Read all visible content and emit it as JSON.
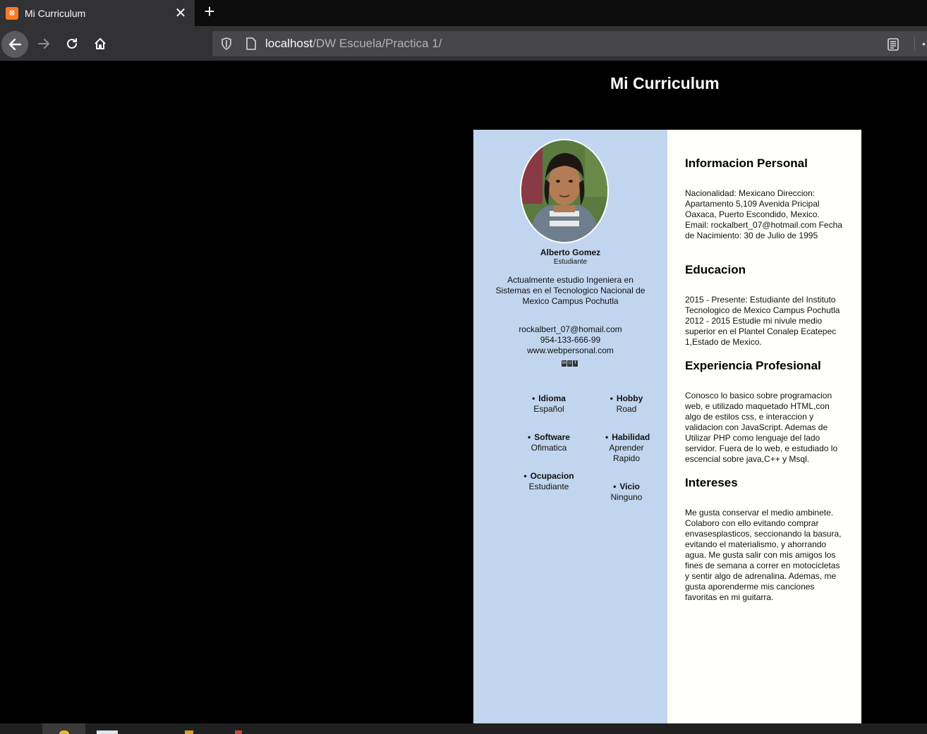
{
  "browser": {
    "tab_title": "Mi Curriculum",
    "tab_favicon_text": "⦻",
    "close_icon": "✕",
    "newtab_icon": "+",
    "url_host": "localhost",
    "url_path": "/DW Escuela/Practica 1/",
    "more_icon": "•"
  },
  "page": {
    "title": "Mi Curriculum"
  },
  "profile": {
    "name": "Alberto Gomez",
    "role": "Estudiante",
    "summary": "Actualmente estudio Ingeniera en Sistemas en el Tecnologico Nacional de Mexico Campus Pochutla",
    "email": "rockalbert_07@homail.com",
    "phone": "954-133-666-99",
    "website": "www.webpersonal.com",
    "socials": [
      "in",
      "◎",
      "f"
    ]
  },
  "info": {
    "idioma": {
      "label": "Idioma",
      "value": "Español"
    },
    "hobby": {
      "label": "Hobby",
      "value": "Road"
    },
    "software": {
      "label": "Software",
      "value": "Ofimatica"
    },
    "habilidad": {
      "label": "Habilidad",
      "value": "Aprender Rapido"
    },
    "ocupacion": {
      "label": "Ocupacion",
      "value": "Estudiante"
    },
    "vicio": {
      "label": "Vicio",
      "value": "Ninguno"
    }
  },
  "sections": {
    "personal": {
      "title": "Informacion Personal",
      "text": "Nacionalidad: Mexicano Direccion: Apartamento 5,109 Avenida Pricipal Oaxaca, Puerto Escondido, Mexico. Email: rockalbert_07@hotmail.com Fecha de Nacimiento: 30 de Julio de 1995"
    },
    "educacion": {
      "title": "Educacion",
      "text": "2015 - Presente: Estudiante del Instituto Tecnologico de Mexico Campus Pochutla 2012 - 2015 Estudie mi nivule medio superior en el Plantel Conalep Ecatepec 1,Estado de Mexico."
    },
    "experiencia": {
      "title": "Experiencia Profesional",
      "text": "Conosco lo basico sobre programacion web, e utilizado maquetado HTML,con algo de estilos css, e interaccion y validacion con JavaScript. Ademas de Utilizar PHP como lenguaje del lado servidor. Fuera de lo web, e estudiado lo escencial sobre java,C++ y Msql."
    },
    "intereses": {
      "title": "Intereses",
      "text": "Me gusta conservar el medio ambinete. Colaboro con ello evitando comprar envasesplasticos, seccionando la basura, evitando el materialismo, y ahorrando agua. Me gusta salir con mis amigos los fines de semana a correr en motocicletas y sentir algo de adrenalina. Ademas, me gusta aporenderme mis canciones favoritas en mi guitarra."
    }
  },
  "colors": {
    "left_column": "#c2d5ee",
    "right_column": "#fffffb",
    "page_background": "#000000",
    "chrome": "#323234"
  }
}
